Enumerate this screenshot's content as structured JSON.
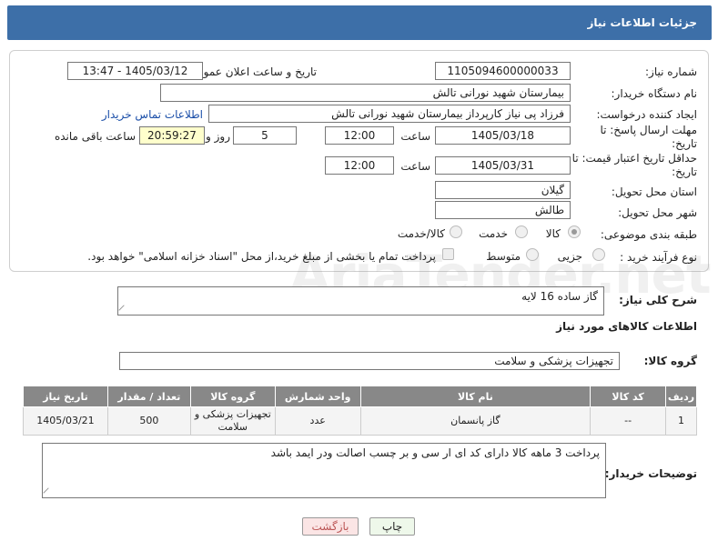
{
  "header": {
    "title": "جزئیات اطلاعات نیاز"
  },
  "form": {
    "need_number_label": "شماره نیاز:",
    "need_number": "1105094600000033",
    "announce_label": "تاریخ و ساعت اعلان عمومی:",
    "announce_value": "1405/03/12 - 13:47",
    "buyer_org_label": "نام دستگاه خریدار:",
    "buyer_org": "بیمارستان شهید نورانی تالش",
    "requester_label": "ایجاد کننده درخواست:",
    "requester": "فرزاد پی نیاز کارپرداز بیمارستان شهید نورانی تالش",
    "contact_link": "اطلاعات تماس خریدار",
    "deadline_label": "مهلت ارسال پاسخ: تا تاریخ:",
    "deadline_date": "1405/03/18",
    "time_label": "ساعت",
    "deadline_time": "12:00",
    "days": "5",
    "days_label": "روز و",
    "remaining": "20:59:27",
    "remaining_label": "ساعت باقی مانده",
    "validity_label": "حداقل تاریخ اعتبار قیمت: تا تاریخ:",
    "validity_date": "1405/03/31",
    "validity_time": "12:00",
    "province_label": "استان محل تحویل:",
    "province": "گیلان",
    "city_label": "شهر محل تحویل:",
    "city": "طالش",
    "category_label": "طبقه بندی موضوعی:",
    "category_options": [
      "کالا",
      "خدمت",
      "کالا/خدمت"
    ],
    "process_label": "نوع فرآیند خرید :",
    "process_options": [
      "جزیی",
      "متوسط"
    ],
    "payment_note": "پرداخت تمام یا بخشی از مبلغ خرید،از محل \"اسناد خزانه اسلامی\" خواهد بود."
  },
  "summary": {
    "label": "شرح کلی نیاز:",
    "value": "گاز ساده 16 لایه"
  },
  "goods": {
    "section_title": "اطلاعات کالاهای مورد نیاز",
    "group_label": "گروه کالا:",
    "group_value": "تجهیزات پزشکی و سلامت",
    "columns": [
      "ردیف",
      "کد کالا",
      "نام کالا",
      "واحد شمارش",
      "گروه کالا",
      "تعداد / مقدار",
      "تاریخ نیاز"
    ],
    "rows": [
      [
        "1",
        "--",
        "گاز پانسمان",
        "عدد",
        "تجهیزات پزشکی و سلامت",
        "500",
        "1405/03/21"
      ]
    ]
  },
  "buyer_notes": {
    "label": "توضیحات خریدار:",
    "value": "پرداخت 3 ماهه کالا دارای کد ای ار سی و بر چسب اصالت ودر ایمد باشد"
  },
  "buttons": {
    "print": "چاپ",
    "back": "بازگشت"
  },
  "watermark": "AriaTender.net"
}
